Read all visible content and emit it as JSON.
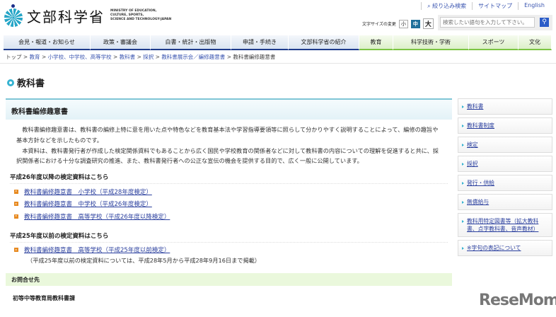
{
  "header": {
    "logo_jp": "文部科学省",
    "logo_en": [
      "MINISTRY OF EDUCATION,",
      "CULTURE, SPORTS,",
      "SCIENCE AND TECHNOLOGY-JAPAN"
    ],
    "top_links": [
      "絞り込み検索",
      "サイトマップ",
      "English"
    ],
    "font_size_label": "文字サイズの変更",
    "font_sizes": [
      "小",
      "中",
      "大"
    ],
    "search_placeholder": "検索したい語句を入力して下さい。"
  },
  "nav": [
    {
      "label": "会見・報道・お知らせ",
      "group": "blue"
    },
    {
      "label": "政策・審議会",
      "group": "blue"
    },
    {
      "label": "白書・統計・出版物",
      "group": "blue"
    },
    {
      "label": "申請・手続き",
      "group": "blue"
    },
    {
      "label": "文部科学省の紹介",
      "group": "blue"
    },
    {
      "label": "教育",
      "group": "green"
    },
    {
      "label": "科学技術・学術",
      "group": "green"
    },
    {
      "label": "スポーツ",
      "group": "green"
    },
    {
      "label": "文化",
      "group": "green"
    }
  ],
  "breadcrumb": [
    "トップ",
    "教育",
    "小学校、中学校、高等学校",
    "教科書",
    "採択",
    "教科書展示会／編修趣意書",
    "教科書編修趣意書"
  ],
  "page_title": "教科書",
  "main": {
    "heading": "教科書編修趣意書",
    "para1": "教科書編修趣意書は、教科書の編修上特に意を用いた点や特色などを教育基本法や学習指導要領等に照らして分かりやすく説明することによって、編修の趣旨や基本方針などを示したものです。",
    "para2": "本資料は、教科書発行者が作成した検定関係資料でもあることから広く国民や学校教育の関係者などに対して教科書の内容についての理解を促進すると共に、採択関係者における十分な調査研究の推進、また、教科書発行者への公正な宣伝の機会を提供する目的で、広く一般に公開しています。",
    "section1": {
      "title": "平成26年度以降の検定資料はこちら",
      "links": [
        "教科書編修趣意書　小学校（平成28年度検定）",
        "教科書編修趣意書　中学校（平成26年度検定）",
        "教科書編修趣意書　高等学校（平成26年度以降検定）"
      ]
    },
    "section2": {
      "title": "平成25年度以前の検定資料はこちら",
      "links": [
        "教科書編修趣意書　高等学校（平成25年度以前検定）"
      ],
      "note": "（平成25年度以前の検定資料については、平成28年5月から平成28年9月16日まで掲載）"
    },
    "contact_heading": "お問合せ先",
    "contact_dept": "初等中等教育局教科書課"
  },
  "sidebar": [
    "教科書",
    "教科書制度",
    "検定",
    "採択",
    "発行・供給",
    "無償給与",
    "教科用特定図書等（拡大教科書、点字教科書、音声教材）",
    "※字句の表記について"
  ],
  "watermark": "ReseMom",
  "colors": {
    "nav_blue": "#1f3c8c",
    "nav_green": "#7cc444",
    "accent": "#36b3d1",
    "link": "#2a3f9e",
    "bullet": "#e78a21"
  }
}
